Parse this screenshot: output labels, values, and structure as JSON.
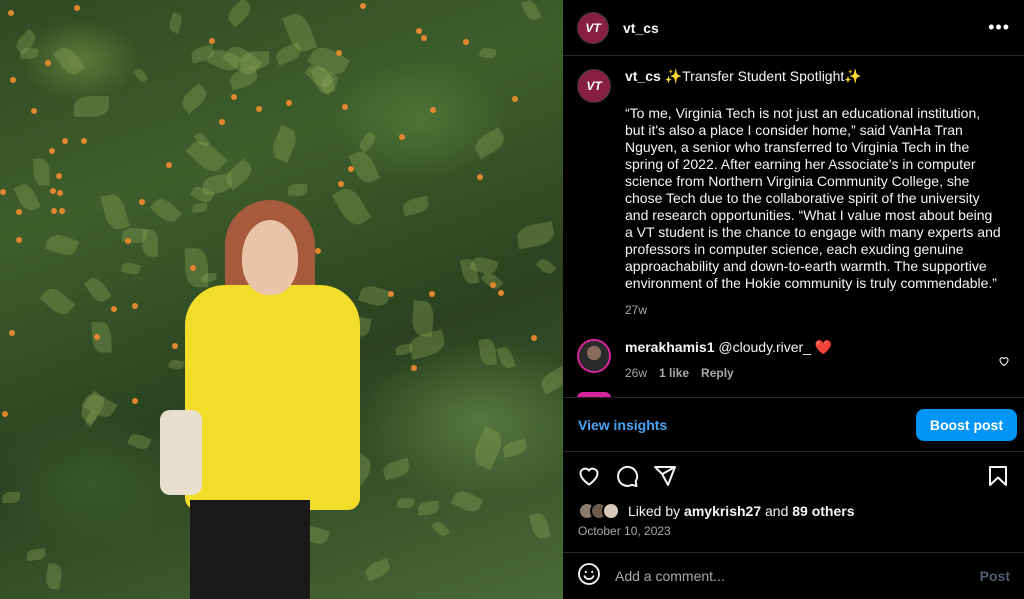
{
  "post": {
    "username": "vt_cs",
    "avatar_text": "VT",
    "more_icon": "more-horizontal-icon"
  },
  "caption": {
    "username": "vt_cs",
    "headline": "✨Transfer Student Spotlight✨",
    "text": "“To me, Virginia Tech is not just an educational institution, but it's also a place I consider home,” said VanHa Tran Nguyen, a senior who transferred to Virginia Tech in the spring of 2022. After earning her Associate's in computer science from Northern Virginia Community College, she chose Tech due to the collaborative spirit of the university and research opportunities. “What I value most about being a VT student is the chance to engage with many experts and professors in computer science, each exuding genuine approachability and down-to-earth warmth. The supportive environment of the Hokie community is truly commendable.”",
    "time": "27w"
  },
  "comment": {
    "username": "merakhamis1",
    "mention": "@cloudy.river_",
    "emoji": "❤️",
    "time": "26w",
    "likes": "1 like",
    "reply": "Reply"
  },
  "insights": {
    "view_label": "View insights",
    "boost_label": "Boost post"
  },
  "likes": {
    "prefix": "Liked by",
    "user": "amykrish27",
    "joiner": "and",
    "others": "89 others"
  },
  "date": "October 10, 2023",
  "add_comment": {
    "placeholder": "Add a comment...",
    "post_label": "Post"
  },
  "colors": {
    "accent": "#0095f6",
    "link": "#4aa3f5",
    "vt_maroon": "#861f41"
  }
}
